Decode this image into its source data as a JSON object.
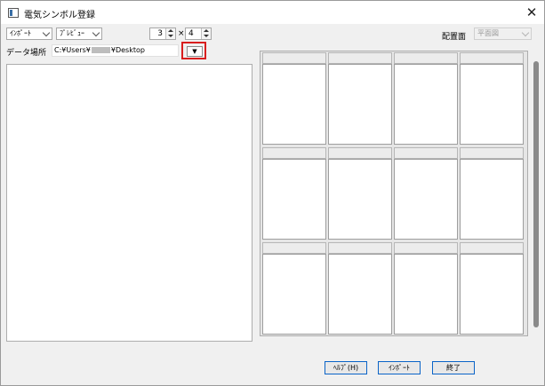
{
  "window": {
    "title": "電気シンボル登録",
    "close": "✕"
  },
  "toolbar": {
    "import_combo": "ｲﾝﾎﾟｰﾄ",
    "preview_combo": "ﾌﾟﾚﾋﾞｭｰ",
    "rows": "3",
    "times": "×",
    "cols": "4",
    "layout_label": "配置面",
    "layout_value": "平面図"
  },
  "data_location": {
    "label": "データ場所",
    "path_prefix": "C:¥Users¥",
    "path_suffix": "¥Desktop",
    "browse_glyph": "▼"
  },
  "buttons": {
    "help": "ﾍﾙﾌﾟ(H)",
    "import": "ｲﾝﾎﾟｰﾄ",
    "close": "終了"
  }
}
